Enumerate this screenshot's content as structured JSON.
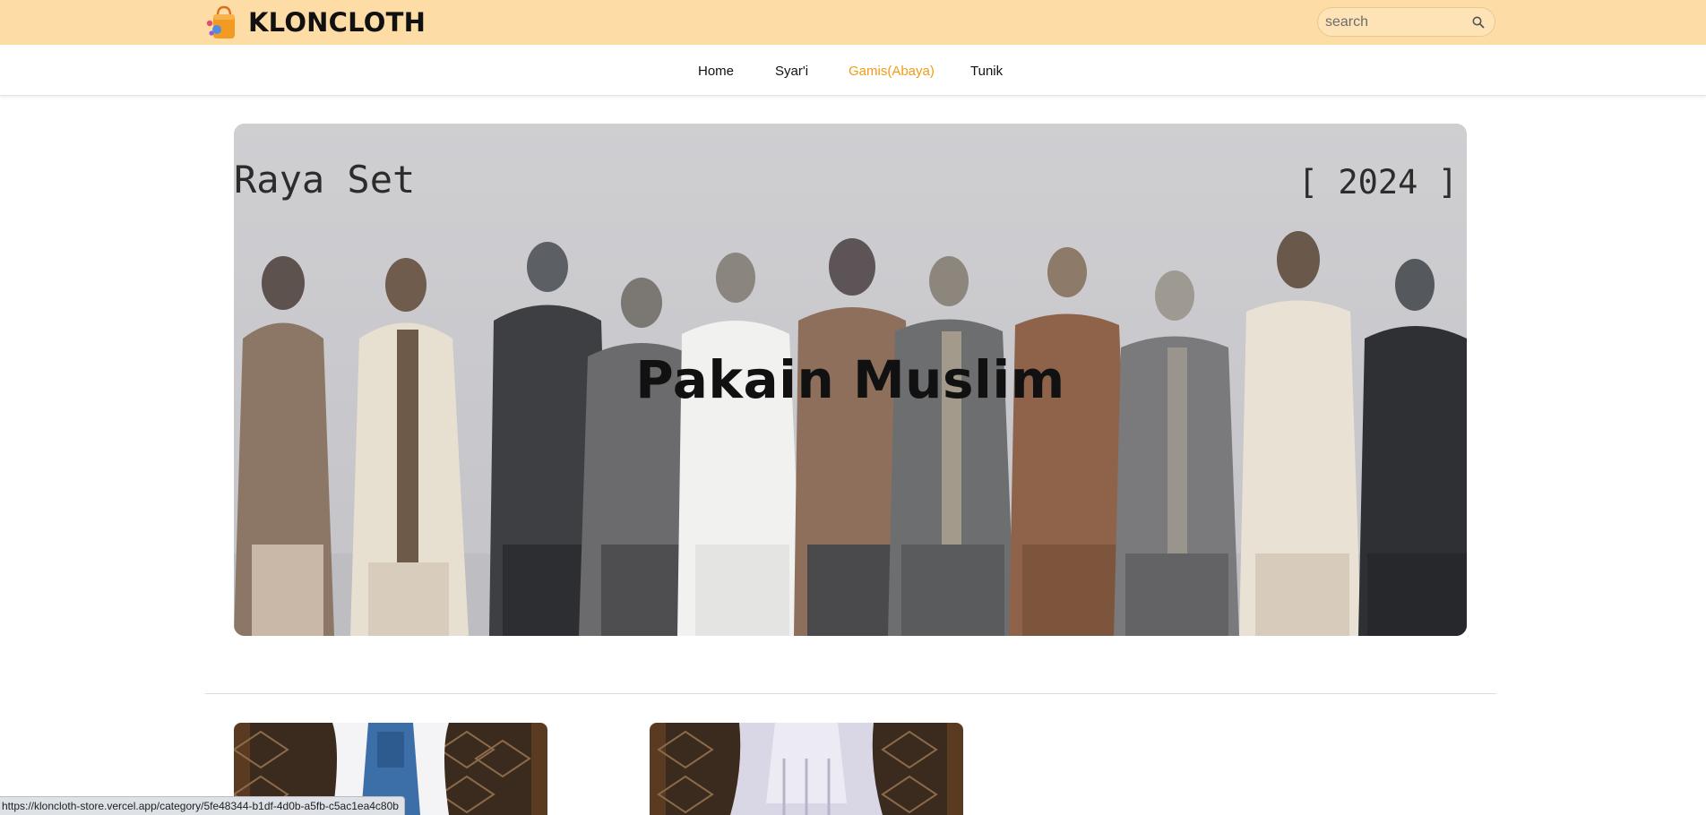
{
  "header": {
    "brand_name": "KLONCLOTH",
    "brand_icon": "shopping-bag-icon",
    "search": {
      "placeholder": "search",
      "value": "",
      "icon": "search-icon"
    },
    "background_color": "#fddca5"
  },
  "nav": {
    "items": [
      {
        "label": "Home",
        "active": false
      },
      {
        "label": "Syar'i",
        "active": false
      },
      {
        "label": "Gamis(Abaya)",
        "active": true
      },
      {
        "label": "Tunik",
        "active": false
      }
    ],
    "active_color": "#f29b16"
  },
  "hero": {
    "title": "Pakain Muslim",
    "image_text_left": "Raya Set",
    "image_text_right": "[ 2024 ]"
  },
  "products": [
    {
      "image": "product-photo-denim-outfit"
    },
    {
      "image": "product-photo-lilac-hijab-outfit"
    }
  ],
  "status_bar": {
    "url": "https://kloncloth-store.vercel.app/category/5fe48344-b1df-4d0b-a5fb-c5ac1ea4c80b"
  }
}
